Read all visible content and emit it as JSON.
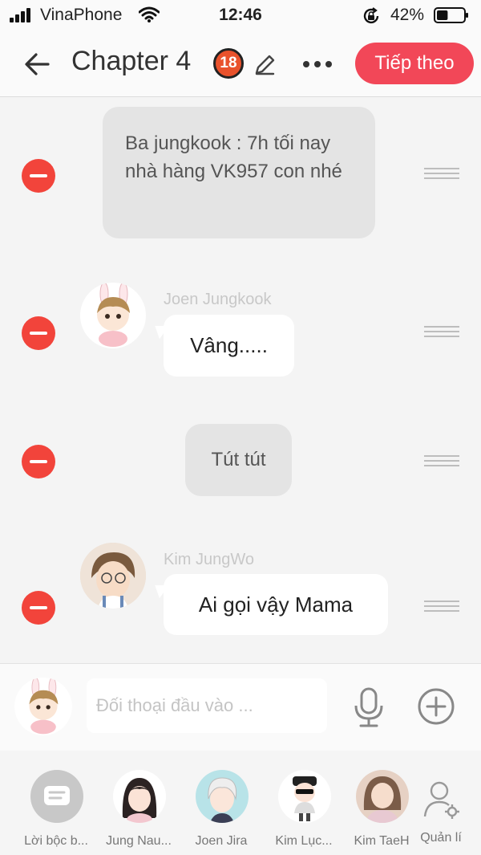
{
  "status": {
    "carrier": "VinaPhone",
    "time": "12:46",
    "battery_percent": "42%",
    "battery_level": 0.42
  },
  "header": {
    "title": "Chapter 4",
    "age_badge": "18",
    "next_button": "Tiếp theo"
  },
  "messages": [
    {
      "type": "narration",
      "text": "Ba jungkook : 7h tối nay nhà hàng VK957 con nhé"
    },
    {
      "type": "character",
      "sender": "Joen Jungkook",
      "text": "Vâng....."
    },
    {
      "type": "narration",
      "text": "Tút tút"
    },
    {
      "type": "character",
      "sender": "Kim JungWo",
      "text": "Ai gọi vậy Mama"
    }
  ],
  "input": {
    "placeholder": "Đối thoại đầu vào ..."
  },
  "characters": [
    {
      "name": "Lời bộc b...",
      "icon": "chat-bubble-icon"
    },
    {
      "name": "Jung Nau..."
    },
    {
      "name": "Joen Jira"
    },
    {
      "name": "Kim Lục..."
    },
    {
      "name": "Kim TaeH"
    },
    {
      "name": "Quản lí",
      "icon": "user-settings-icon"
    }
  ],
  "colors": {
    "accent": "#f24758",
    "delete": "#f2443b",
    "narration_bg": "#e4e4e4",
    "bubble_bg": "#ffffff"
  }
}
